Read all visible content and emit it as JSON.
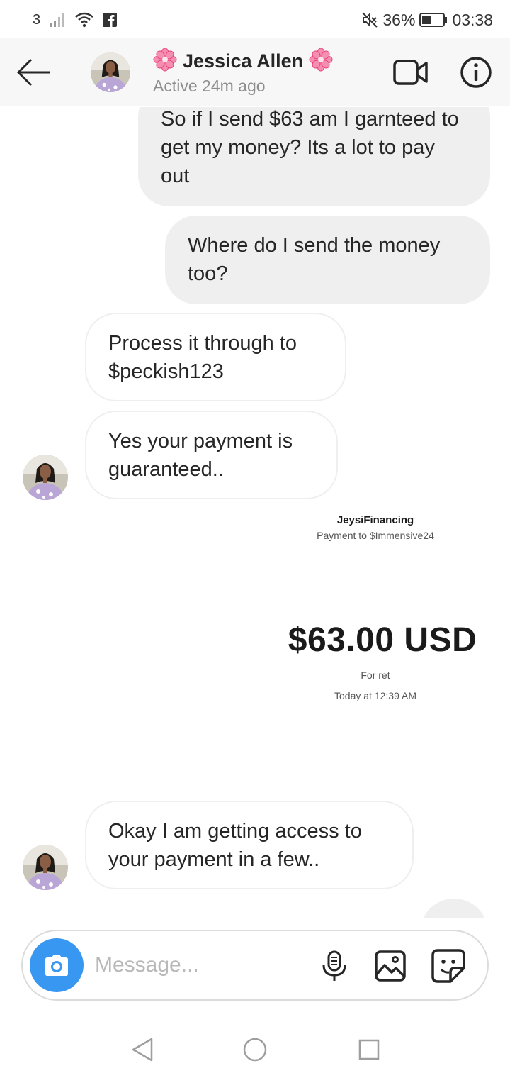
{
  "status_bar": {
    "carrier_label": "3",
    "battery_percent": "36%",
    "time": "03:38",
    "icons": [
      "signal-icon",
      "wifi-icon",
      "facebook-icon",
      "mute-icon",
      "battery-icon"
    ]
  },
  "header": {
    "contact_name": "Jessica Allen",
    "active_status": "Active 24m ago",
    "icons": [
      "back-arrow-icon",
      "flower-icon",
      "video-call-icon",
      "info-icon"
    ]
  },
  "messages": [
    {
      "direction": "outgoing",
      "text": "So if I send $63 am I garnteed to get my money? Its a lot to pay out"
    },
    {
      "direction": "outgoing",
      "text": "Where do I send the money too?"
    },
    {
      "direction": "incoming",
      "text": "Process it through to $peckish123"
    },
    {
      "direction": "incoming",
      "text": "Yes your payment is guaranteed.."
    },
    {
      "direction": "incoming",
      "text": "Okay I am getting access to your payment in a few.."
    }
  ],
  "payment_receipt": {
    "merchant": "JeysiFinancing",
    "payment_to": "Payment to $Immensive24",
    "amount": "$63.00 USD",
    "note": "For ret",
    "timestamp": "Today at 12:39 AM"
  },
  "composer": {
    "placeholder": "Message...",
    "icons": [
      "camera-icon",
      "microphone-icon",
      "gallery-icon",
      "sticker-icon"
    ]
  },
  "colors": {
    "accent": "#3897f0",
    "outgoing_bubble": "#efefef",
    "incoming_border": "#efefef",
    "secondary_text": "#8e8e8e",
    "flower": "#f06292"
  }
}
